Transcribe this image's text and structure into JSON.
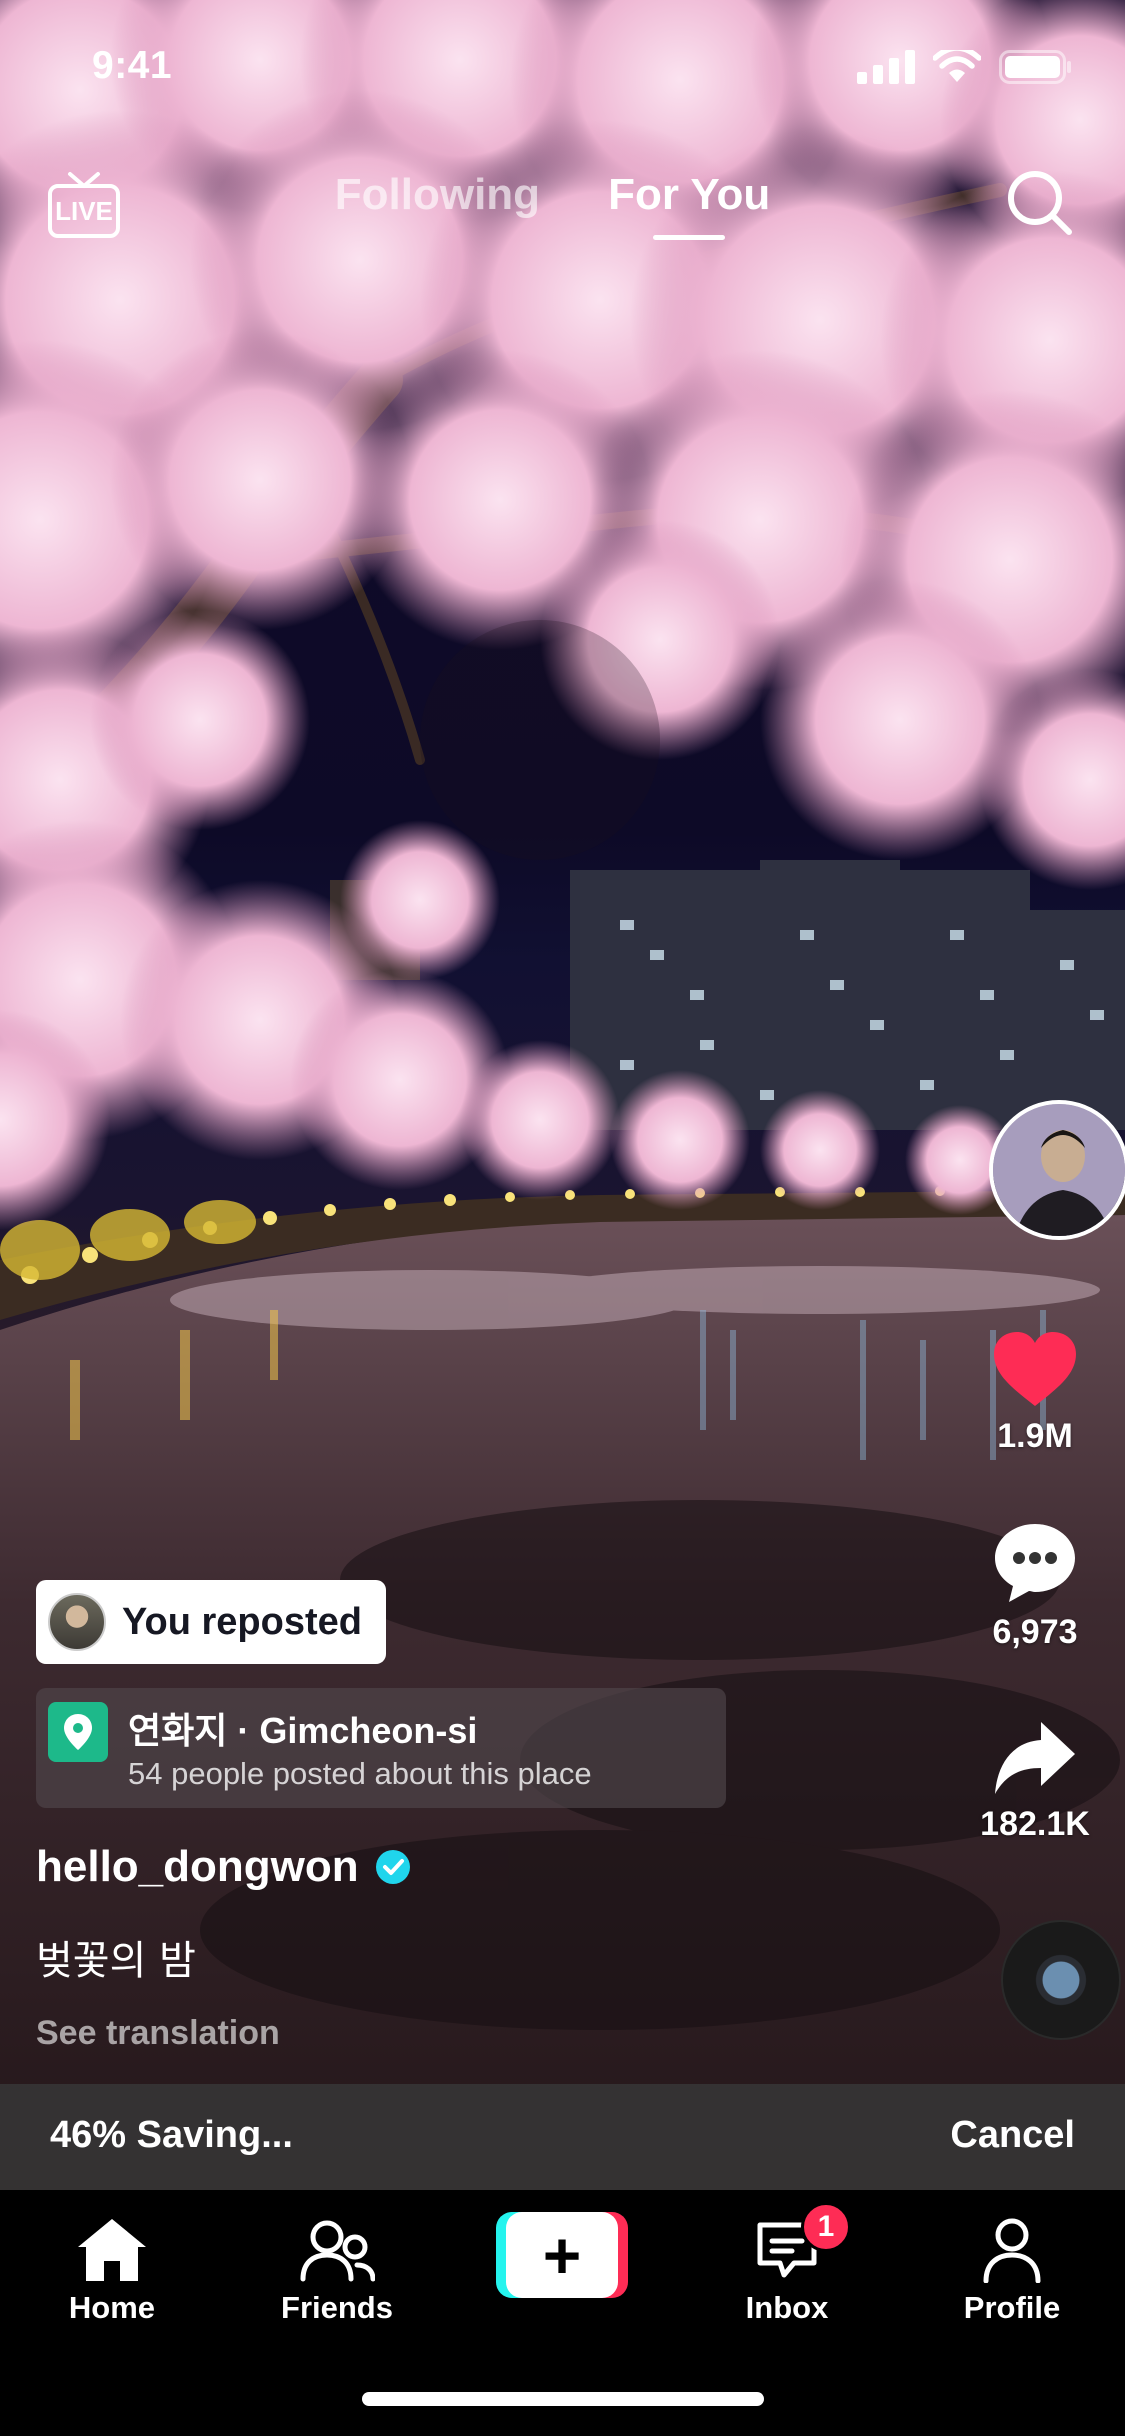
{
  "status_bar": {
    "time": "9:41"
  },
  "top_nav": {
    "live_label": "LIVE",
    "tabs": [
      {
        "label": "Following",
        "active": false
      },
      {
        "label": "For You",
        "active": true
      }
    ]
  },
  "actions": {
    "likes": "1.9M",
    "comments": "6,973",
    "shares": "182.1K"
  },
  "post": {
    "repost_label": "You reposted",
    "location": {
      "title": "연화지 · Gimcheon-si",
      "subtitle": "54 people posted about this place"
    },
    "username": "hello_dongwon",
    "verified": true,
    "caption": "벚꽃의 밤",
    "see_translation": "See translation"
  },
  "saving": {
    "progress_text": "46% Saving...",
    "progress": 0.46,
    "cancel_label": "Cancel"
  },
  "tab_bar": {
    "home": "Home",
    "friends": "Friends",
    "inbox": "Inbox",
    "inbox_badge": "1",
    "profile": "Profile",
    "create_symbol": "+"
  },
  "colors": {
    "like_red": "#fe2c55",
    "verified_blue": "#20d5ec",
    "create_cyan": "#25f4ee",
    "location_green": "#1db98a"
  }
}
